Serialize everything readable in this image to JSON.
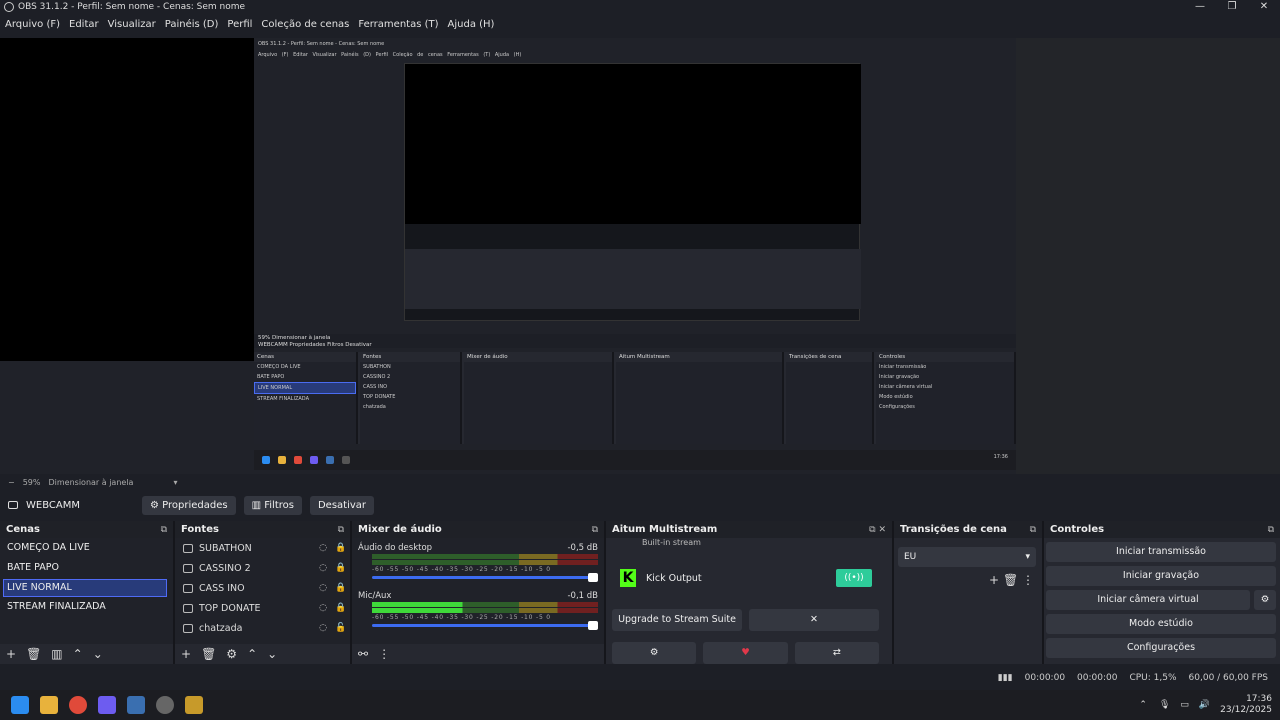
{
  "title": "OBS 31.1.2 - Perfil: Sem nome - Cenas: Sem nome",
  "window_controls": [
    "—",
    "❐",
    "✕"
  ],
  "menu": [
    "Arquivo (F)",
    "Editar",
    "Visualizar",
    "Painéis (D)",
    "Perfil",
    "Coleção de cenas",
    "Ferramentas (T)",
    "Ajuda (H)"
  ],
  "preview": {
    "nested_title": "OBS 31.1.2 - Perfil: Sem nome - Cenas: Sem nome",
    "nested_menu": "Arquivo (F)  Editar  Visualizar  Painéis (D)  Perfil  Coleção de cenas  Ferramentas (T)  Ajuda (H)",
    "nested_toolbar": "WEBCAMM   Propriedades   Filtros   Desativar",
    "nested_zoom": "59%   Dimensionar à janela",
    "nested_headers": [
      "Cenas",
      "Fontes",
      "Mixer de áudio",
      "Aitum Multistream",
      "Transições de cena",
      "Controles"
    ],
    "nested_scenes": [
      "COMEÇO DA LIVE",
      "BATE PAPO",
      "LIVE NORMAL",
      "STREAM FINALIZADA"
    ],
    "nested_sources": [
      "SUBATHON",
      "CASSINO 2",
      "CASS INO",
      "TOP DONATE",
      "chatzada"
    ],
    "nested_controls": [
      "Iniciar transmissão",
      "Iniciar gravação",
      "Iniciar câmera virtual",
      "Modo estúdio",
      "Configurações"
    ],
    "nested_clock": "17:36"
  },
  "zoom": {
    "percent": "59%",
    "fit": "Dimensionar à janela"
  },
  "sourcebar": {
    "name": "WEBCAMM",
    "properties": "Propriedades",
    "filters": "Filtros",
    "disable": "Desativar"
  },
  "docks": {
    "scenes": {
      "title": "Cenas",
      "items": [
        "COMEÇO DA LIVE",
        "BATE PAPO",
        "LIVE NORMAL",
        "STREAM FINALIZADA"
      ],
      "selected": "LIVE NORMAL"
    },
    "sources": {
      "title": "Fontes",
      "items": [
        "SUBATHON",
        "CASSINO 2",
        "CASS INO",
        "TOP DONATE",
        "chatzada"
      ]
    },
    "mixer": {
      "title": "Mixer de áudio",
      "channels": [
        {
          "name": "Áudio do desktop",
          "db": "-0,5 dB",
          "level": 0
        },
        {
          "name": "Mic/Aux",
          "db": "-0,1 dB",
          "level": 0.4
        }
      ],
      "scale": "-60 -55 -50 -45 -40 -35 -30 -25 -20 -15 -10 -5 0"
    },
    "aitum": {
      "title": "Aitum Multistream",
      "partial": "Built-in stream",
      "output": "Kick Output",
      "upgrade": "Upgrade to Stream Suite",
      "close": "✕"
    },
    "transitions": {
      "title": "Transições de cena",
      "selected": "EU"
    },
    "controls": {
      "title": "Controles",
      "buttons": [
        "Iniciar transmissão",
        "Iniciar gravação",
        "Iniciar câmera virtual",
        "Modo estúdio",
        "Configurações"
      ]
    }
  },
  "status": {
    "rec_time": "00:00:00",
    "stream_time": "00:00:00",
    "cpu": "CPU: 1,5%",
    "fps": "60,00 / 60,00 FPS"
  },
  "taskbar": {
    "time": "17:36",
    "date": "23/12/2025"
  }
}
